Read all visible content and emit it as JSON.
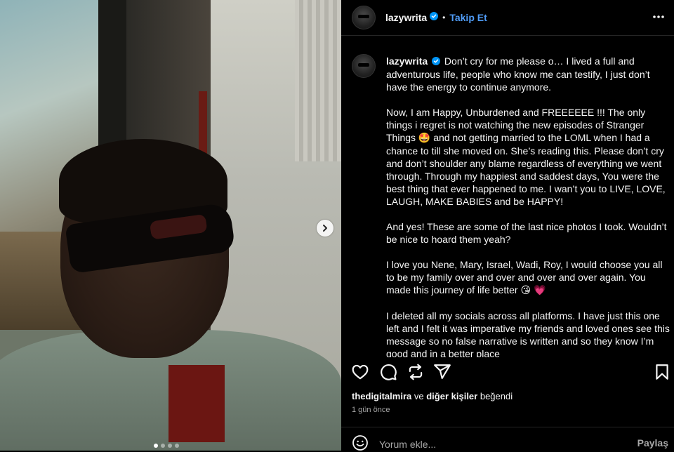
{
  "carousel": {
    "slide_count": 4,
    "active_slide": 1,
    "next_icon": "chevron-right-icon"
  },
  "post": {
    "username": "lazywrita",
    "verified": true,
    "follow_label": "Takip Et",
    "separator": "•",
    "more_icon": "more-horizontal-icon"
  },
  "caption": {
    "username": "lazywrita",
    "p1": "Don’t cry for me please o… I lived a full and adventurous life, people who know me can testify, I just don’t have the energy to continue anymore.",
    "p2a": "Now, I am Happy, Unburdened and FREEEEEE !!! The only things i regret is not watching the new episodes of Stranger Things ",
    "p2_emoji": "🤩",
    "p2b": " and not getting married to the LOML when I had a chance to till she moved on. She’s reading this. Please don’t cry and don’t shoulder any blame regardless of everything we went through. Through my happiest and saddest days, You were the best thing that ever happened to me. I wan’t you to LIVE, LOVE, LAUGH, MAKE BABIES and be HAPPY!",
    "p3": "And yes! These are some of the last nice photos I took. Wouldn’t be nice to hoard them yeah?",
    "p4a": "I love you Nene, Mary, Israel, Wadi, Roy, I would choose you all to be my family over and over and over and over again. You made this journey of life better ",
    "p4_emoji1": "😘",
    "p4_emoji2": "💗",
    "p5": "I deleted all my socials across all platforms. I have just this one left and I felt it was imperative my friends and loved ones see this message so no false narrative is written and so they know I’m good and in a better place"
  },
  "actions": {
    "like_icon": "heart-icon",
    "comment_icon": "comment-icon",
    "repost_icon": "repost-icon",
    "share_icon": "send-icon",
    "save_icon": "bookmark-icon"
  },
  "likes": {
    "user": "thedigitalmira",
    "connector": "ve",
    "others": "diğer kişiler",
    "suffix": "beğendi"
  },
  "timestamp": "1 gün önce",
  "comment": {
    "placeholder": "Yorum ekle...",
    "post_label": "Paylaş",
    "emoji_icon": "smiley-icon"
  },
  "colors": {
    "accent": "#4f9bf5",
    "background": "#000000",
    "text": "#f5f5f5",
    "muted": "#a8a8a8"
  }
}
